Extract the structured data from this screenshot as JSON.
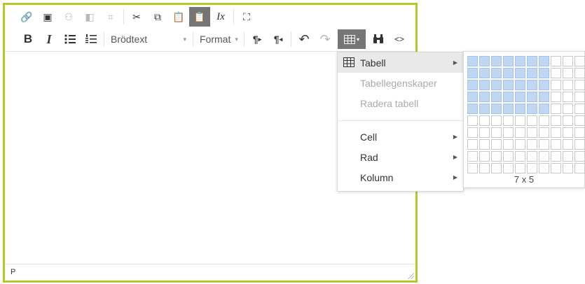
{
  "toolbar": {
    "row1": [
      {
        "name": "link-button",
        "icon": "link-icon",
        "glyph": "🔗",
        "disabled": true
      },
      {
        "name": "media-button",
        "icon": "film-icon",
        "glyph": "▣",
        "disabled": false
      },
      {
        "name": "anchor-button",
        "icon": "people-icon",
        "glyph": "⚇",
        "disabled": true
      },
      {
        "name": "image-button",
        "icon": "image-icon",
        "glyph": "◧",
        "disabled": true
      },
      {
        "name": "crop-button",
        "icon": "crop-icon",
        "glyph": "⌗",
        "disabled": true
      },
      {
        "sep": true
      },
      {
        "name": "cut-button",
        "icon": "scissors-icon",
        "glyph": "✂",
        "disabled": false
      },
      {
        "name": "copy-button",
        "icon": "copy-icon",
        "glyph": "⧉",
        "disabled": false
      },
      {
        "name": "paste-button",
        "icon": "paste-icon",
        "glyph": "📋",
        "disabled": false
      },
      {
        "name": "paste-text-button",
        "icon": "clipboard-text-icon",
        "glyph": "📋",
        "active": true
      },
      {
        "name": "clear-format-button",
        "icon": "clear-formatting-icon",
        "glyph": "Ix",
        "disabled": false
      },
      {
        "sep": true
      },
      {
        "name": "fullscreen-button",
        "icon": "fullscreen-icon",
        "glyph": "⛶",
        "disabled": false
      }
    ],
    "bold": "B",
    "italic": "I",
    "style_select": "Brödtext",
    "format_select": "Format",
    "ltr_glyph": "¶",
    "rtl_glyph": "¶",
    "undo_glyph": "↶",
    "redo_glyph": "↷",
    "table_glyph": "▦",
    "caret": "▾",
    "find_glyph": "⚲",
    "code_glyph": "<>"
  },
  "statusbar": {
    "path": "P"
  },
  "table_menu": {
    "items": [
      {
        "label": "Tabell",
        "icon": "table-icon",
        "submenu": true,
        "active": true,
        "disabled": false
      },
      {
        "label": "Tabellegenskaper",
        "submenu": false,
        "active": false,
        "disabled": true
      },
      {
        "label": "Radera tabell",
        "submenu": false,
        "active": false,
        "disabled": true
      },
      {
        "sep": true
      },
      {
        "label": "Cell",
        "submenu": true,
        "active": false,
        "disabled": false
      },
      {
        "label": "Rad",
        "submenu": true,
        "active": false,
        "disabled": false
      },
      {
        "label": "Kolumn",
        "submenu": true,
        "active": false,
        "disabled": false
      }
    ]
  },
  "table_grid": {
    "cols": 10,
    "rows": 10,
    "selected_cols": 7,
    "selected_rows": 5,
    "label": "7 x 5"
  },
  "colors": {
    "editor_border": "#b5c827",
    "selected_cell": "#bfd7f5",
    "table_button_bg": "#757575"
  }
}
